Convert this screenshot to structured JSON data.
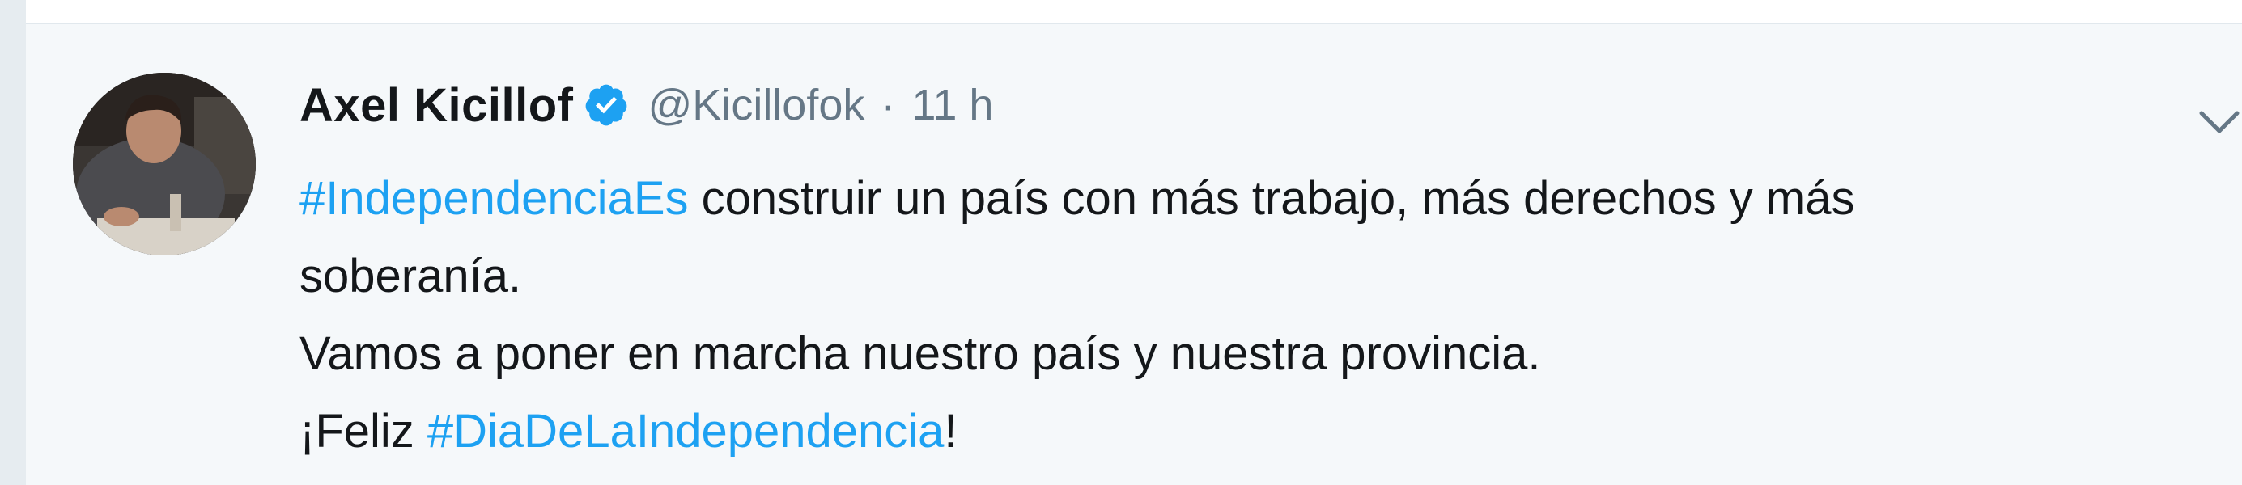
{
  "tweet": {
    "display_name": "Axel Kicillof",
    "handle": "@Kicillofok",
    "separator": "·",
    "time": "11 h",
    "verified_icon": "verified-badge-icon",
    "menu_icon": "chevron-down-icon",
    "body": {
      "line1_hashtag": "#IndependenciaEs",
      "line1_text": " construir un país con más trabajo, más derechos y más",
      "line2_text": "soberanía.",
      "line3_text": "Vamos a poner en marcha nuestro país y nuestra provincia.",
      "line4_prefix": "¡Feliz ",
      "line4_hashtag": "#DiaDeLaIndependencia",
      "line4_suffix": "!"
    }
  },
  "colors": {
    "hashtag": "#1da1f2",
    "verified": "#1da1f2",
    "muted_text": "#657786",
    "text": "#14171a",
    "tweet_background": "#f5f8fa"
  }
}
